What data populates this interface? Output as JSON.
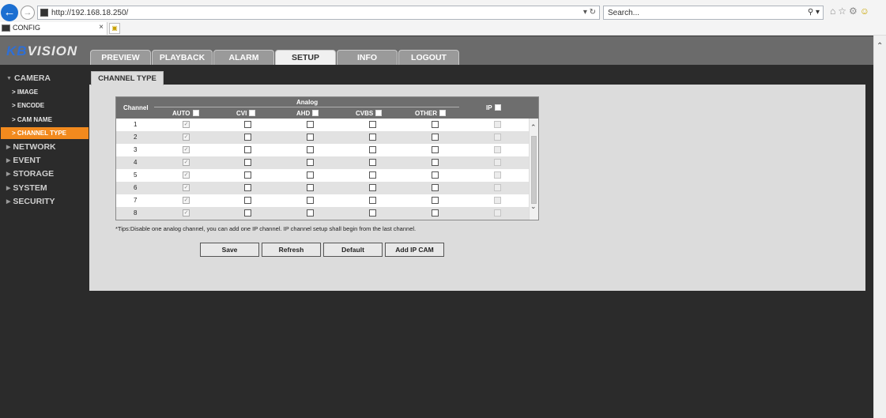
{
  "browser": {
    "url": "http://192.168.18.250/",
    "search_placeholder": "Search...",
    "tab_title": "CONFIG"
  },
  "app": {
    "logo_kb": "KB",
    "logo_vision": "VISION",
    "nav_tabs": [
      "PREVIEW",
      "PLAYBACK",
      "ALARM",
      "SETUP",
      "INFO",
      "LOGOUT"
    ],
    "active_tab": "SETUP"
  },
  "sidebar": {
    "camera": "CAMERA",
    "camera_items": [
      "IMAGE",
      "ENCODE",
      "CAM NAME",
      "CHANNEL TYPE"
    ],
    "active_item": "CHANNEL TYPE",
    "sections": [
      "NETWORK",
      "EVENT",
      "STORAGE",
      "SYSTEM",
      "SECURITY"
    ]
  },
  "content": {
    "tab_title": "CHANNEL TYPE",
    "table": {
      "channel_header": "Channel",
      "analog_header": "Analog",
      "columns": [
        "AUTO",
        "CVI",
        "AHD",
        "CVBS",
        "OTHER"
      ],
      "ip_header": "IP",
      "rows": [
        {
          "channel": "1",
          "auto": true,
          "cvi": false,
          "ahd": false,
          "cvbs": false,
          "other": false,
          "ip": false
        },
        {
          "channel": "2",
          "auto": true,
          "cvi": false,
          "ahd": false,
          "cvbs": false,
          "other": false,
          "ip": false
        },
        {
          "channel": "3",
          "auto": true,
          "cvi": false,
          "ahd": false,
          "cvbs": false,
          "other": false,
          "ip": false
        },
        {
          "channel": "4",
          "auto": true,
          "cvi": false,
          "ahd": false,
          "cvbs": false,
          "other": false,
          "ip": false
        },
        {
          "channel": "5",
          "auto": true,
          "cvi": false,
          "ahd": false,
          "cvbs": false,
          "other": false,
          "ip": false
        },
        {
          "channel": "6",
          "auto": true,
          "cvi": false,
          "ahd": false,
          "cvbs": false,
          "other": false,
          "ip": false
        },
        {
          "channel": "7",
          "auto": true,
          "cvi": false,
          "ahd": false,
          "cvbs": false,
          "other": false,
          "ip": false
        },
        {
          "channel": "8",
          "auto": true,
          "cvi": false,
          "ahd": false,
          "cvbs": false,
          "other": false,
          "ip": false
        }
      ]
    },
    "tips": "*Tips:Disable one analog channel, you can add one IP channel. IP channel setup shall begin from the last channel.",
    "buttons": {
      "save": "Save",
      "refresh": "Refresh",
      "default": "Default",
      "add_ip_cam": "Add IP CAM"
    }
  }
}
